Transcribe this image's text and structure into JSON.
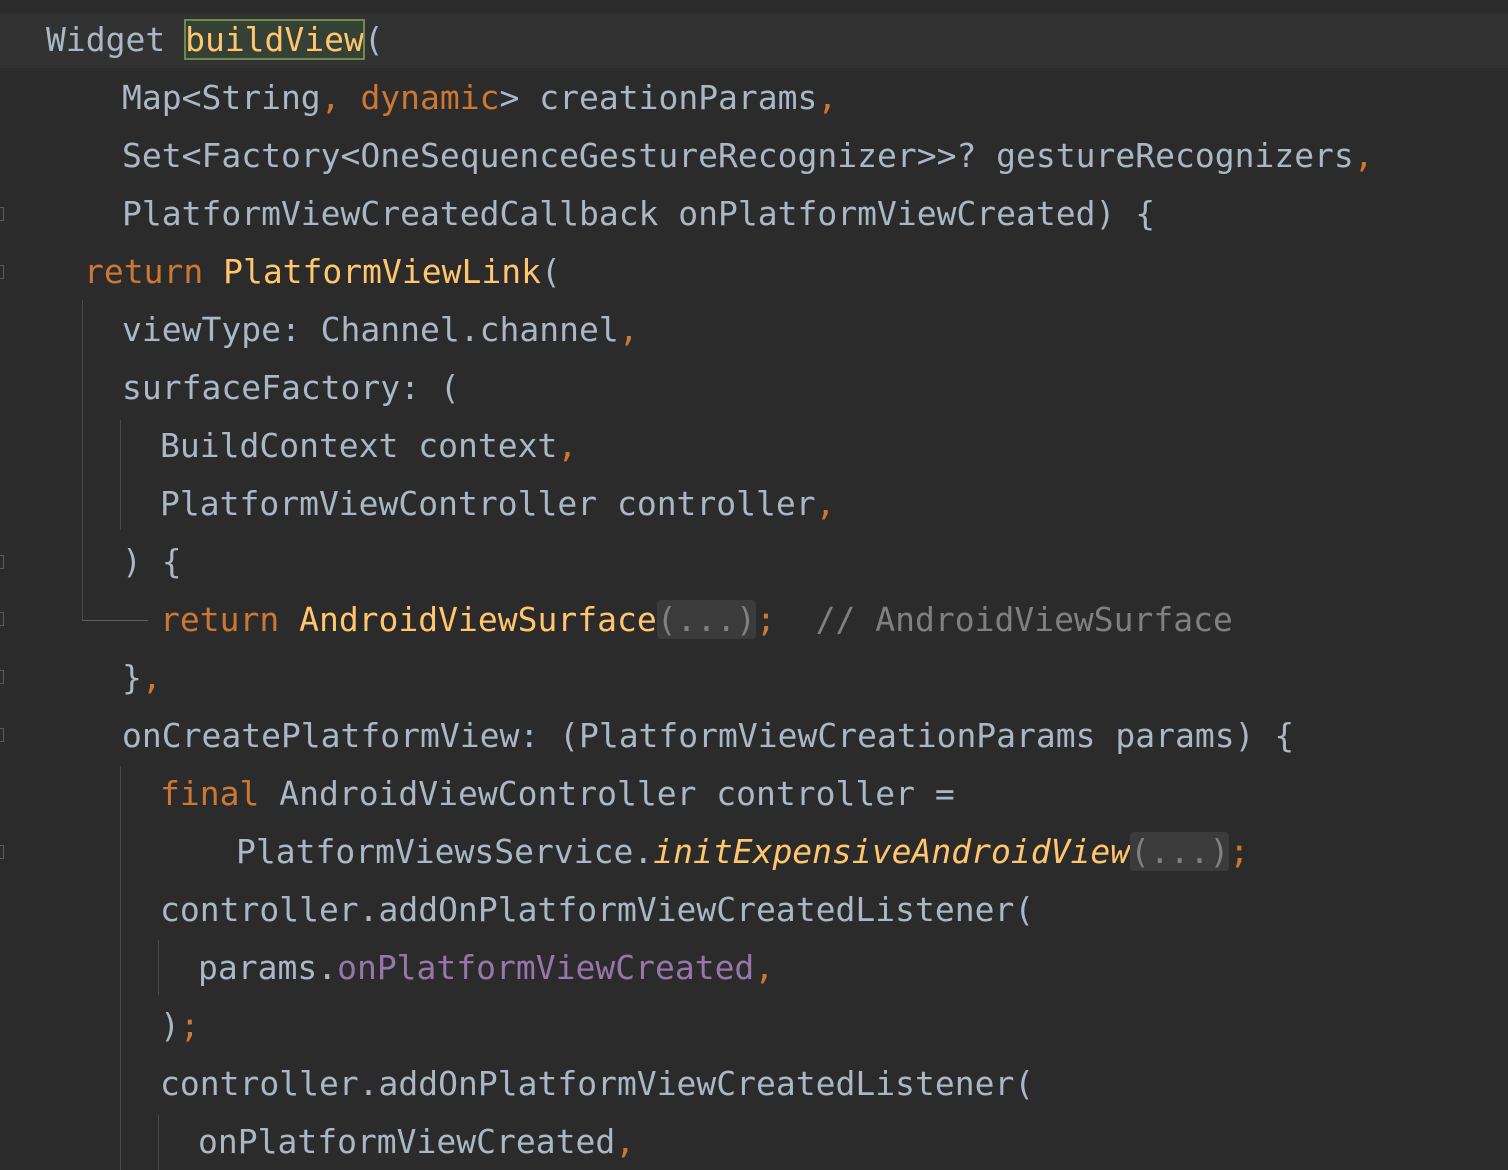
{
  "colors": {
    "background": "#2b2b2b",
    "current_line": "#323232",
    "default_text": "#a9b7c6",
    "keyword": "#cc7832",
    "function_name": "#ffc66d",
    "comment": "#808080",
    "field": "#9876aa",
    "highlight_bg": "#344134",
    "fold_bg": "#3b3b3b"
  },
  "code": {
    "lines": [
      {
        "indent": 0,
        "tokens": [
          {
            "t": "Widget ",
            "k": "plain"
          },
          {
            "t": "buildView",
            "k": "match"
          },
          {
            "t": "(",
            "k": "plain"
          }
        ]
      },
      {
        "indent": 2,
        "tokens": [
          {
            "t": "Map<String",
            "k": "plain"
          },
          {
            "t": ", ",
            "k": "kw"
          },
          {
            "t": "dynamic",
            "k": "kw"
          },
          {
            "t": "> creationParams",
            "k": "plain"
          },
          {
            "t": ",",
            "k": "kw"
          }
        ]
      },
      {
        "indent": 2,
        "tokens": [
          {
            "t": "Set<Factory<OneSequenceGestureRecognizer>>? gestureRecognizers",
            "k": "plain"
          },
          {
            "t": ",",
            "k": "kw"
          }
        ]
      },
      {
        "indent": 2,
        "tokens": [
          {
            "t": "PlatformViewCreatedCallback onPlatformViewCreated) {",
            "k": "plain"
          }
        ]
      },
      {
        "indent": 1,
        "tokens": [
          {
            "t": "return ",
            "k": "kw"
          },
          {
            "t": "PlatformViewLink",
            "k": "fn"
          },
          {
            "t": "(",
            "k": "plain"
          }
        ]
      },
      {
        "indent": 2,
        "tokens": [
          {
            "t": "viewType: Channel.channel",
            "k": "plain"
          },
          {
            "t": ",",
            "k": "kw"
          }
        ]
      },
      {
        "indent": 2,
        "tokens": [
          {
            "t": "surfaceFactory: (",
            "k": "plain"
          }
        ]
      },
      {
        "indent": 3,
        "tokens": [
          {
            "t": "BuildContext context",
            "k": "plain"
          },
          {
            "t": ",",
            "k": "kw"
          }
        ]
      },
      {
        "indent": 3,
        "tokens": [
          {
            "t": "PlatformViewController controller",
            "k": "plain"
          },
          {
            "t": ",",
            "k": "kw"
          }
        ]
      },
      {
        "indent": 2,
        "tokens": [
          {
            "t": ") {",
            "k": "plain"
          }
        ]
      },
      {
        "indent": 3,
        "tokens": [
          {
            "t": "return ",
            "k": "kw"
          },
          {
            "t": "AndroidViewSurface",
            "k": "fn"
          },
          {
            "t": "(...)",
            "k": "fold"
          },
          {
            "t": ";",
            "k": "kw"
          },
          {
            "t": "  // AndroidViewSurface",
            "k": "comment"
          }
        ]
      },
      {
        "indent": 2,
        "tokens": [
          {
            "t": "}",
            "k": "plain"
          },
          {
            "t": ",",
            "k": "kw"
          }
        ]
      },
      {
        "indent": 2,
        "tokens": [
          {
            "t": "onCreatePlatformView: (PlatformViewCreationParams params) {",
            "k": "plain"
          }
        ]
      },
      {
        "indent": 3,
        "tokens": [
          {
            "t": "final ",
            "k": "kw"
          },
          {
            "t": "AndroidViewController controller =",
            "k": "plain"
          }
        ]
      },
      {
        "indent": 5,
        "tokens": [
          {
            "t": "PlatformViewsService.",
            "k": "plain"
          },
          {
            "t": "initExpensiveAndroidView",
            "k": "fn-italic"
          },
          {
            "t": "(...)",
            "k": "fold"
          },
          {
            "t": ";",
            "k": "kw"
          }
        ]
      },
      {
        "indent": 3,
        "tokens": [
          {
            "t": "controller.addOnPlatformViewCreatedListener(",
            "k": "plain"
          }
        ]
      },
      {
        "indent": 4,
        "tokens": [
          {
            "t": "params.",
            "k": "plain"
          },
          {
            "t": "onPlatformViewCreated",
            "k": "field"
          },
          {
            "t": ",",
            "k": "kw"
          }
        ]
      },
      {
        "indent": 3,
        "tokens": [
          {
            "t": ")",
            "k": "plain"
          },
          {
            "t": ";",
            "k": "kw"
          }
        ]
      },
      {
        "indent": 3,
        "tokens": [
          {
            "t": "controller.addOnPlatformViewCreatedListener(",
            "k": "plain"
          }
        ]
      },
      {
        "indent": 4,
        "tokens": [
          {
            "t": "onPlatformViewCreated",
            "k": "plain"
          },
          {
            "t": ",",
            "k": "kw"
          }
        ]
      }
    ]
  }
}
